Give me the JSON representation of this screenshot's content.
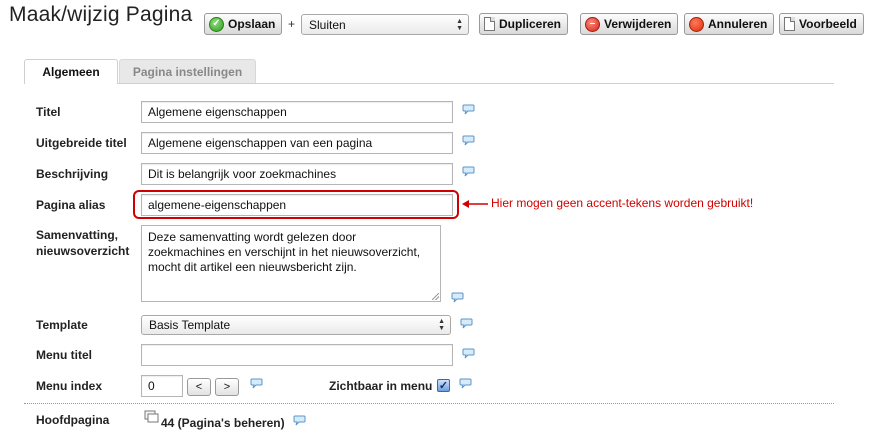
{
  "page": {
    "title": "Maak/wijzig Pagina"
  },
  "toolbar": {
    "save_label": "Opslaan",
    "plus": "+",
    "close_select_value": "Sluiten",
    "duplicate_label": "Dupliceren",
    "delete_label": "Verwijderen",
    "cancel_label": "Annuleren",
    "preview_label": "Voorbeeld"
  },
  "tabs": [
    {
      "label": "Algemeen",
      "active": true
    },
    {
      "label": "Pagina instellingen",
      "active": false
    }
  ],
  "form": {
    "title": {
      "label": "Titel",
      "value": "Algemene eigenschappen"
    },
    "extended_title": {
      "label": "Uitgebreide titel",
      "value": "Algemene eigenschappen van een pagina"
    },
    "description": {
      "label": "Beschrijving",
      "value": "Dit is belangrijk voor zoekmachines"
    },
    "alias": {
      "label": "Pagina alias",
      "value": "algemene-eigenschappen"
    },
    "summary": {
      "label_line1": "Samenvatting,",
      "label_line2": "nieuwsoverzicht",
      "value": "Deze samenvatting wordt gelezen door\nzoekmachines en verschijnt in het nieuwsoverzicht,\nmocht dit artikel een nieuwsbericht zijn."
    },
    "template": {
      "label": "Template",
      "value": "Basis Template"
    },
    "menu_title": {
      "label": "Menu titel",
      "value": ""
    },
    "menu_index": {
      "label": "Menu index",
      "value": "0",
      "prev": "<",
      "next": ">"
    },
    "visible_in_menu": {
      "label": "Zichtbaar in menu",
      "checked": true
    },
    "parent_page": {
      "label": "Hoofdpagina",
      "value": "44 (Pagina's beheren)"
    }
  },
  "annotation": {
    "text": "Hier mogen geen accent-tekens worden gebruikt!",
    "color": "#d10000"
  },
  "colors": {
    "annotation": "#d10000",
    "tab_active_bg": "#ffffff",
    "tab_inactive_bg": "#e8e8e8"
  }
}
